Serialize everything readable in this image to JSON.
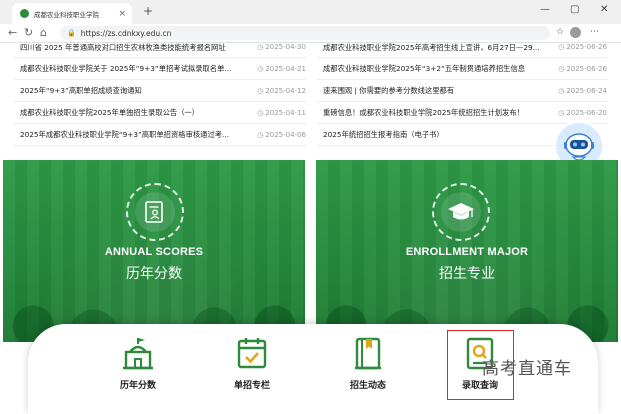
{
  "browser": {
    "tab_title": "成都农业科技职业学院",
    "tab_close": "×",
    "new_tab": "+",
    "url": "https://zs.cdnkxy.edu.cn",
    "win_min": "—",
    "win_max": "▢",
    "win_close": "✕"
  },
  "news_left": [
    {
      "title": "四川省 2025 年普通高校对口招生农林牧渔类技能统考报名网址",
      "date": "2025-04-30"
    },
    {
      "title": "成都农业科技职业学院关于 2025年“9+3”单招考试拟录取名单...",
      "date": "2025-04-21"
    },
    {
      "title": "2025年“9+3”高职单招成绩查询通知",
      "date": "2025-04-12"
    },
    {
      "title": "成都农业科技职业学院2025年单独招生录取公告（一）",
      "date": "2025-04-11"
    },
    {
      "title": "2025年成都农业科技职业学院“9+3”高职单招资格审核通过考...",
      "date": "2025-04-06"
    }
  ],
  "news_right": [
    {
      "title": "成都农业科技职业学院2025年高考招生线上宣讲，6月27日—29...",
      "date": "2025-06-26"
    },
    {
      "title": "成都农业科技职业学院2025年“3+2”五年制贯通培养招生信息",
      "date": "2025-06-26"
    },
    {
      "title": "速来围观 | 你需要的参考分数线这里都有",
      "date": "2025-06-24"
    },
    {
      "title": "重磅信息！成都农业科技职业学院2025年统招招生计划发布！",
      "date": "2025-06-20"
    },
    {
      "title": "2025年统招招生报考指南（电子书）",
      "date": ""
    }
  ],
  "banners": {
    "left": {
      "en": "ANNUAL SCORES",
      "cn": "历年分数"
    },
    "right": {
      "en": "ENROLLMENT MAJOR",
      "cn": "招生专业"
    }
  },
  "bottom_nav": [
    {
      "label": "历年分数"
    },
    {
      "label": "单招专栏"
    },
    {
      "label": "招生动态"
    },
    {
      "label": "录取查询"
    }
  ],
  "watermark": "高考直通车",
  "colors": {
    "brand_green": "#2f8a3c",
    "highlight_red": "#e0242a"
  }
}
